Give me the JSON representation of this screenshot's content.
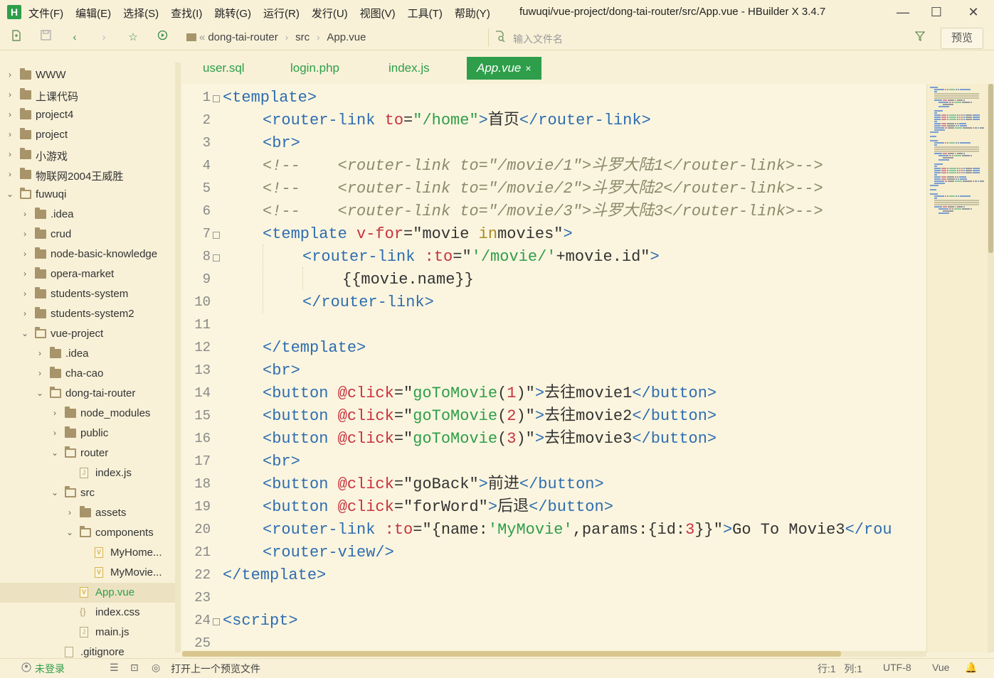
{
  "window": {
    "logo": "H",
    "title": "fuwuqi/vue-project/dong-tai-router/src/App.vue - HBuilder X 3.4.7",
    "menu": [
      "文件(F)",
      "编辑(E)",
      "选择(S)",
      "查找(I)",
      "跳转(G)",
      "运行(R)",
      "发行(U)",
      "视图(V)",
      "工具(T)",
      "帮助(Y)"
    ],
    "controls": {
      "minimize": "—",
      "maximize": "☐",
      "close": "✕"
    }
  },
  "toolbar": {
    "breadcrumb": [
      "dong-tai-router",
      "src",
      "App.vue"
    ],
    "breadcrumb_prefix": "«",
    "file_search_placeholder": "输入文件名",
    "preview_label": "预览"
  },
  "sidebar": {
    "items": [
      {
        "label": "WWW",
        "chevron": "›",
        "icon": "folder",
        "depth": 0
      },
      {
        "label": "上课代码",
        "chevron": "›",
        "icon": "folder",
        "depth": 0
      },
      {
        "label": "project4",
        "chevron": "›",
        "icon": "folder",
        "depth": 0
      },
      {
        "label": "project",
        "chevron": "›",
        "icon": "folder",
        "depth": 0
      },
      {
        "label": "小游戏",
        "chevron": "›",
        "icon": "folder",
        "depth": 0
      },
      {
        "label": "物联网2004王威胜",
        "chevron": "›",
        "icon": "folder",
        "depth": 0
      },
      {
        "label": "fuwuqi",
        "chevron": "⌄",
        "icon": "folder-open",
        "depth": 0
      },
      {
        "label": ".idea",
        "chevron": "›",
        "icon": "folder",
        "depth": 1
      },
      {
        "label": "crud",
        "chevron": "›",
        "icon": "folder",
        "depth": 1
      },
      {
        "label": "node-basic-knowledge",
        "chevron": "›",
        "icon": "folder",
        "depth": 1
      },
      {
        "label": "opera-market",
        "chevron": "›",
        "icon": "folder",
        "depth": 1
      },
      {
        "label": "students-system",
        "chevron": "›",
        "icon": "folder",
        "depth": 1
      },
      {
        "label": "students-system2",
        "chevron": "›",
        "icon": "folder",
        "depth": 1
      },
      {
        "label": "vue-project",
        "chevron": "⌄",
        "icon": "folder-open",
        "depth": 1
      },
      {
        "label": ".idea",
        "chevron": "›",
        "icon": "folder",
        "depth": 2
      },
      {
        "label": "cha-cao",
        "chevron": "›",
        "icon": "folder",
        "depth": 2
      },
      {
        "label": "dong-tai-router",
        "chevron": "⌄",
        "icon": "folder-open",
        "depth": 2
      },
      {
        "label": "node_modules",
        "chevron": "›",
        "icon": "folder",
        "depth": 3
      },
      {
        "label": "public",
        "chevron": "›",
        "icon": "folder",
        "depth": 3
      },
      {
        "label": "router",
        "chevron": "⌄",
        "icon": "folder-open",
        "depth": 3
      },
      {
        "label": "index.js",
        "chevron": "",
        "icon": "file-js",
        "depth": 4
      },
      {
        "label": "src",
        "chevron": "⌄",
        "icon": "folder-open",
        "depth": 3
      },
      {
        "label": "assets",
        "chevron": "›",
        "icon": "folder",
        "depth": 4
      },
      {
        "label": "components",
        "chevron": "⌄",
        "icon": "folder-open",
        "depth": 4
      },
      {
        "label": "MyHome...",
        "chevron": "",
        "icon": "file-vue",
        "depth": 5
      },
      {
        "label": "MyMovie...",
        "chevron": "",
        "icon": "file-vue",
        "depth": 5
      },
      {
        "label": "App.vue",
        "chevron": "",
        "icon": "file-vue",
        "depth": 4,
        "selected": true
      },
      {
        "label": "index.css",
        "chevron": "",
        "icon": "file-css",
        "depth": 4
      },
      {
        "label": "main.js",
        "chevron": "",
        "icon": "file-js",
        "depth": 4
      },
      {
        "label": ".gitignore",
        "chevron": "",
        "icon": "file",
        "depth": 3
      }
    ]
  },
  "tabs": [
    {
      "label": "user.sql",
      "active": false
    },
    {
      "label": "login.php",
      "active": false
    },
    {
      "label": "index.js",
      "active": false
    },
    {
      "label": "App.vue",
      "active": true,
      "close": "×"
    }
  ],
  "editor": {
    "lines": [
      {
        "n": "1",
        "fold": "⊟",
        "indent": 0,
        "tokens": [
          [
            "tg",
            "<template>"
          ]
        ]
      },
      {
        "n": "2",
        "fold": "",
        "indent": 2,
        "tokens": [
          [
            "tg",
            "<router-link "
          ],
          [
            "at",
            "to"
          ],
          [
            "",
            "="
          ],
          [
            "st",
            "\"/home\""
          ],
          [
            "tg",
            ">"
          ],
          [
            "",
            "首页"
          ],
          [
            "tg",
            "</router-link>"
          ]
        ]
      },
      {
        "n": "3",
        "fold": "",
        "indent": 2,
        "tokens": [
          [
            "tg",
            "<br>"
          ]
        ]
      },
      {
        "n": "4",
        "fold": "",
        "indent": 2,
        "tokens": [
          [
            "cm",
            "<!--    <router-link to=\"/movie/1\">斗罗大陆1</router-link>-->"
          ]
        ]
      },
      {
        "n": "5",
        "fold": "",
        "indent": 2,
        "tokens": [
          [
            "cm",
            "<!--    <router-link to=\"/movie/2\">斗罗大陆2</router-link>-->"
          ]
        ]
      },
      {
        "n": "6",
        "fold": "",
        "indent": 2,
        "tokens": [
          [
            "cm",
            "<!--    <router-link to=\"/movie/3\">斗罗大陆3</router-link>-->"
          ]
        ]
      },
      {
        "n": "7",
        "fold": "⊟",
        "indent": 2,
        "tokens": [
          [
            "tg",
            "<template "
          ],
          [
            "at",
            "v-for"
          ],
          [
            "",
            "=\"movie "
          ],
          [
            "kw",
            "in"
          ],
          [
            "",
            "movies\""
          ],
          [
            "tg",
            ">"
          ]
        ]
      },
      {
        "n": "8",
        "fold": "⊟",
        "indent": 4,
        "tokens": [
          [
            "tg",
            "<router-link "
          ],
          [
            "at",
            ":to"
          ],
          [
            "",
            "=\""
          ],
          [
            "st",
            "'/movie/'"
          ],
          [
            "",
            "+movie.id\""
          ],
          [
            "tg",
            ">"
          ]
        ]
      },
      {
        "n": "9",
        "fold": "",
        "indent": 6,
        "tokens": [
          [
            "",
            "{{movie.name}}"
          ]
        ]
      },
      {
        "n": "10",
        "fold": "",
        "indent": 4,
        "tokens": [
          [
            "tg",
            "</router-link>"
          ]
        ]
      },
      {
        "n": "11",
        "fold": "",
        "indent": 0,
        "tokens": []
      },
      {
        "n": "12",
        "fold": "",
        "indent": 2,
        "tokens": [
          [
            "tg",
            "</template>"
          ]
        ]
      },
      {
        "n": "13",
        "fold": "",
        "indent": 2,
        "tokens": [
          [
            "tg",
            "<br>"
          ]
        ]
      },
      {
        "n": "14",
        "fold": "",
        "indent": 2,
        "tokens": [
          [
            "tg",
            "<button "
          ],
          [
            "at",
            "@click"
          ],
          [
            "",
            "=\""
          ],
          [
            "st",
            "goToMovie"
          ],
          [
            "",
            "("
          ],
          [
            "num",
            "1"
          ],
          [
            "",
            ")\""
          ],
          [
            "tg",
            ">"
          ],
          [
            "",
            "去往movie1"
          ],
          [
            "tg",
            "</button>"
          ]
        ]
      },
      {
        "n": "15",
        "fold": "",
        "indent": 2,
        "tokens": [
          [
            "tg",
            "<button "
          ],
          [
            "at",
            "@click"
          ],
          [
            "",
            "=\""
          ],
          [
            "st",
            "goToMovie"
          ],
          [
            "",
            "("
          ],
          [
            "num",
            "2"
          ],
          [
            "",
            ")\""
          ],
          [
            "tg",
            ">"
          ],
          [
            "",
            "去往movie2"
          ],
          [
            "tg",
            "</button>"
          ]
        ]
      },
      {
        "n": "16",
        "fold": "",
        "indent": 2,
        "tokens": [
          [
            "tg",
            "<button "
          ],
          [
            "at",
            "@click"
          ],
          [
            "",
            "=\""
          ],
          [
            "st",
            "goToMovie"
          ],
          [
            "",
            "("
          ],
          [
            "num",
            "3"
          ],
          [
            "",
            ")\""
          ],
          [
            "tg",
            ">"
          ],
          [
            "",
            "去往movie3"
          ],
          [
            "tg",
            "</button>"
          ]
        ]
      },
      {
        "n": "17",
        "fold": "",
        "indent": 2,
        "tokens": [
          [
            "tg",
            "<br>"
          ]
        ]
      },
      {
        "n": "18",
        "fold": "",
        "indent": 2,
        "tokens": [
          [
            "tg",
            "<button "
          ],
          [
            "at",
            "@click"
          ],
          [
            "",
            "=\"goBack\""
          ],
          [
            "tg",
            ">"
          ],
          [
            "",
            "前进"
          ],
          [
            "tg",
            "</button>"
          ]
        ]
      },
      {
        "n": "19",
        "fold": "",
        "indent": 2,
        "tokens": [
          [
            "tg",
            "<button "
          ],
          [
            "at",
            "@click"
          ],
          [
            "",
            "=\"forWord\""
          ],
          [
            "tg",
            ">"
          ],
          [
            "",
            "后退"
          ],
          [
            "tg",
            "</button>"
          ]
        ]
      },
      {
        "n": "20",
        "fold": "",
        "indent": 2,
        "tokens": [
          [
            "tg",
            "<router-link "
          ],
          [
            "at",
            ":to"
          ],
          [
            "",
            "=\"{name:"
          ],
          [
            "st",
            "'MyMovie'"
          ],
          [
            "",
            ",params:{id:"
          ],
          [
            "num",
            "3"
          ],
          [
            "",
            "}}\""
          ],
          [
            "tg",
            ">"
          ],
          [
            "",
            "Go To Movie3"
          ],
          [
            "tg",
            "</rou"
          ]
        ]
      },
      {
        "n": "21",
        "fold": "",
        "indent": 2,
        "tokens": [
          [
            "tg",
            "<router-view/>"
          ]
        ]
      },
      {
        "n": "22",
        "fold": "",
        "indent": 0,
        "tokens": [
          [
            "tg",
            "</template>"
          ]
        ]
      },
      {
        "n": "23",
        "fold": "",
        "indent": 0,
        "tokens": []
      },
      {
        "n": "24",
        "fold": "⊟",
        "indent": 0,
        "tokens": [
          [
            "tg",
            "<script>"
          ]
        ]
      },
      {
        "n": "25",
        "fold": "",
        "indent": 0,
        "tokens": []
      }
    ]
  },
  "statusbar": {
    "login": "未登录",
    "open_preview": "打开上一个预览文件",
    "position": "行:1   列:1",
    "encoding": "UTF-8",
    "language": "Vue"
  },
  "colors": {
    "accent": "#2e9e4a",
    "background": "#f8f1d8",
    "tag": "#2e6db0",
    "attr": "#c7323f",
    "string": "#2e9e4a",
    "comment": "#8a8a6a"
  }
}
